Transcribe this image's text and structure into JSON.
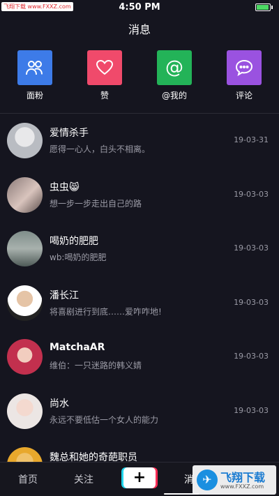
{
  "statusbar": {
    "time": "4:50 PM",
    "watermark": "飞翔下载 www.FXXZ.com"
  },
  "header": {
    "title": "消息"
  },
  "categories": [
    {
      "label": "面粉",
      "icon": "fans-icon",
      "color": "#3d7be8"
    },
    {
      "label": "赞",
      "icon": "heart-icon",
      "color": "#f04a6b"
    },
    {
      "label": "@我的",
      "icon": "at-icon",
      "color": "#23b358"
    },
    {
      "label": "评论",
      "icon": "comment-icon",
      "color": "#9a52e0"
    }
  ],
  "messages": [
    {
      "name": "爱情杀手",
      "text": "愿得一心人，白头不相离。",
      "date": "19-03-31"
    },
    {
      "name": "虫虫😸",
      "text": "想一步一步走出自己的路",
      "date": "19-03-03"
    },
    {
      "name": "喝奶的肥肥",
      "text": "wb:喝奶的肥肥",
      "date": "19-03-03"
    },
    {
      "name": "潘长江",
      "text": "将喜剧进行到底……爱咋咋地!",
      "date": "19-03-03"
    },
    {
      "name": "MatchaAR",
      "text": "维伯：一只迷路的韩义婧",
      "date": "19-03-03"
    },
    {
      "name": "尚水",
      "text": "永远不要低估一个女人的能力",
      "date": "19-03-03"
    },
    {
      "name": "魏总和她的奇葩职员",
      "text": "",
      "date": ""
    }
  ],
  "tabbar": {
    "home": "首页",
    "follow": "关注",
    "plus": "+",
    "msg": "消"
  },
  "watermark_bottom": {
    "title": "飞翔下载",
    "url": "www.FXXZ.com"
  }
}
